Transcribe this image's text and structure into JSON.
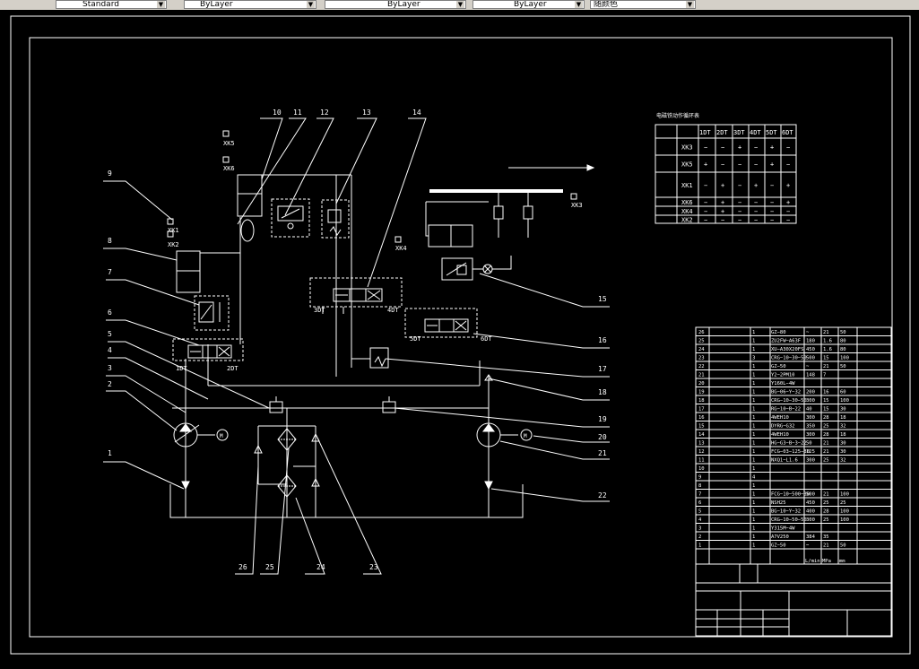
{
  "toolbar": {
    "textstyle": "Standard",
    "layer": "ByLayer",
    "linetype": "ByLayer",
    "lineweight": "ByLayer",
    "color": "随颜色"
  },
  "callouts": [
    "1",
    "2",
    "3",
    "4",
    "5",
    "6",
    "7",
    "8",
    "9",
    "10",
    "11",
    "12",
    "13",
    "14",
    "15",
    "16",
    "17",
    "18",
    "19",
    "20",
    "21",
    "22",
    "23",
    "24",
    "25",
    "26"
  ],
  "solenoids": [
    "1DT",
    "2DT",
    "3DT",
    "4DT",
    "5DT",
    "6DT"
  ],
  "switches": [
    "XK1",
    "XK2",
    "XK3",
    "XK4",
    "XK5",
    "XK6"
  ],
  "table_title": "电磁铁动作循环表",
  "table_header": [
    "1DT",
    "2DT",
    "3DT",
    "4DT",
    "5DT",
    "6DT"
  ],
  "table_rows": [
    {
      "sw": "XK3",
      "v": [
        "−",
        "−",
        "+",
        "−",
        "+",
        "−"
      ]
    },
    {
      "sw": "XK5",
      "v": [
        "+",
        "−",
        "−",
        "−",
        "+",
        "−"
      ]
    },
    {
      "sw": "XK1",
      "v": [
        "−",
        "+",
        "−",
        "+",
        "−",
        "+"
      ]
    },
    {
      "sw": "XK6",
      "v": [
        "−",
        "+",
        "−",
        "−",
        "−",
        "+"
      ]
    },
    {
      "sw": "XK4",
      "v": [
        "−",
        "+",
        "−",
        "−",
        "−",
        "−"
      ]
    },
    {
      "sw": "XK2",
      "v": [
        "−",
        "−",
        "−",
        "−",
        "−",
        "−"
      ]
    }
  ],
  "bom": [
    {
      "n": "26",
      "q": "1",
      "m": "GZ−80",
      "d": "~",
      "p": "21",
      "v": "50"
    },
    {
      "n": "25",
      "q": "1",
      "m": "ZU2FW−A63F",
      "d": "180",
      "p": "1.6",
      "v": "80"
    },
    {
      "n": "24",
      "q": "1",
      "m": "XU−A30X20FS",
      "d": "450",
      "p": "1.6",
      "v": "80"
    },
    {
      "n": "23",
      "q": "3",
      "m": "CRG−10−30−50",
      "d": "500",
      "p": "15",
      "v": "100"
    },
    {
      "n": "22",
      "q": "1",
      "m": "GZ−50",
      "d": "~",
      "p": "21",
      "v": "50"
    },
    {
      "n": "21",
      "q": "1",
      "m": "Y2−2PM10",
      "d": "148",
      "p": "7",
      "v": ""
    },
    {
      "n": "20",
      "q": "1",
      "m": "Y160L−4W",
      "d": "",
      "p": "",
      "v": ""
    },
    {
      "n": "19",
      "q": "1",
      "m": "BG−06−Y−32",
      "d": "200",
      "p": "16",
      "v": "60"
    },
    {
      "n": "18",
      "q": "1",
      "m": "CRG−10−30−50",
      "d": "300",
      "p": "15",
      "v": "100"
    },
    {
      "n": "17",
      "q": "1",
      "m": "RG−10−B−22",
      "d": "40",
      "p": "15",
      "v": "30"
    },
    {
      "n": "16",
      "q": "1",
      "m": "4WEH10",
      "d": "300",
      "p": "28",
      "v": "18"
    },
    {
      "n": "15",
      "q": "1",
      "m": "DYRG−G32",
      "d": "350",
      "p": "25",
      "v": "32"
    },
    {
      "n": "14",
      "q": "1",
      "m": "4WEH10",
      "d": "300",
      "p": "28",
      "v": "18"
    },
    {
      "n": "13",
      "q": "1",
      "m": "HG−G3−B−3−22",
      "d": "50",
      "p": "21",
      "v": "30"
    },
    {
      "n": "12",
      "q": "1",
      "m": "FCG−03−125−30",
      "d": "125",
      "p": "21",
      "v": "30"
    },
    {
      "n": "11",
      "q": "1",
      "m": "NXQ1−L1.6",
      "d": "300",
      "p": "25",
      "v": "32"
    },
    {
      "n": "10",
      "q": "1",
      "m": "",
      "d": "",
      "p": "",
      "v": ""
    },
    {
      "n": "9",
      "q": "4",
      "m": "",
      "d": "",
      "p": "",
      "v": ""
    },
    {
      "n": "8",
      "q": "1",
      "m": "",
      "d": "",
      "p": "",
      "v": ""
    },
    {
      "n": "7",
      "q": "1",
      "m": "FCG−10−500−30",
      "d": "500",
      "p": "21",
      "v": "100"
    },
    {
      "n": "6",
      "q": "1",
      "m": "NSH25",
      "d": "450",
      "p": "25",
      "v": "25"
    },
    {
      "n": "5",
      "q": "1",
      "m": "BG−10−Y−32",
      "d": "400",
      "p": "28",
      "v": "100"
    },
    {
      "n": "4",
      "q": "1",
      "m": "CRG−10−50−50",
      "d": "300",
      "p": "25",
      "v": "100"
    },
    {
      "n": "3",
      "q": "1",
      "m": "Y315M−4W",
      "d": "",
      "p": "",
      "v": ""
    },
    {
      "n": "2",
      "q": "1",
      "m": "A7V250",
      "d": "384",
      "p": "35",
      "v": ""
    },
    {
      "n": "1",
      "q": "1",
      "m": "GZ−50",
      "d": "~",
      "p": "21",
      "v": "50"
    }
  ],
  "bom_units": [
    "L/min",
    "MPa",
    "mm"
  ],
  "colors": {
    "line": "#ffffff",
    "background": "#000000",
    "toolbar": "#d4d0c8"
  }
}
